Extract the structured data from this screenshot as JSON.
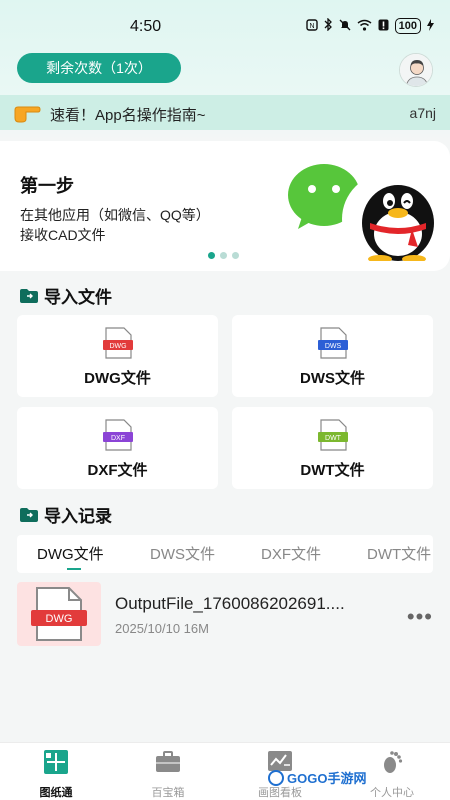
{
  "status": {
    "time": "4:50",
    "battery": "100",
    "signal_icons": [
      "nfc-icon",
      "bluetooth-icon",
      "mute-icon",
      "wifi-icon",
      "alert-icon"
    ]
  },
  "header": {
    "remain_label": "剩余次数（1次）"
  },
  "notice": {
    "text": "速看！App名操作指南~",
    "code": "a7nj"
  },
  "banner": {
    "title": "第一步",
    "line1": "在其他应用（如微信、QQ等）",
    "line2": "接收CAD文件",
    "slides": 3,
    "active_slide": 1
  },
  "import": {
    "title": "导入文件",
    "cards": [
      {
        "label": "DWG文件",
        "tag": "DWG",
        "color": "#e23b3b"
      },
      {
        "label": "DWS文件",
        "tag": "DWS",
        "color": "#2c5fd6"
      },
      {
        "label": "DXF文件",
        "tag": "DXF",
        "color": "#8b44d6"
      },
      {
        "label": "DWT文件",
        "tag": "DWT",
        "color": "#7cb82f"
      }
    ]
  },
  "records": {
    "title": "导入记录",
    "tabs": [
      "DWG文件",
      "DWS文件",
      "DXF文件",
      "DWT文件"
    ],
    "active_tab": 0,
    "items": [
      {
        "thumb_tag": "DWG",
        "name": "OutputFile_1760086202691....",
        "meta": "2025/10/10  16M"
      }
    ]
  },
  "nav": {
    "items": [
      "图纸通",
      "百宝箱",
      "画图看板",
      "个人中心"
    ],
    "active": 0
  },
  "watermark": "GOGO手游网",
  "colors": {
    "accent": "#1aa58c",
    "notice_bg": "#cdeee5"
  }
}
